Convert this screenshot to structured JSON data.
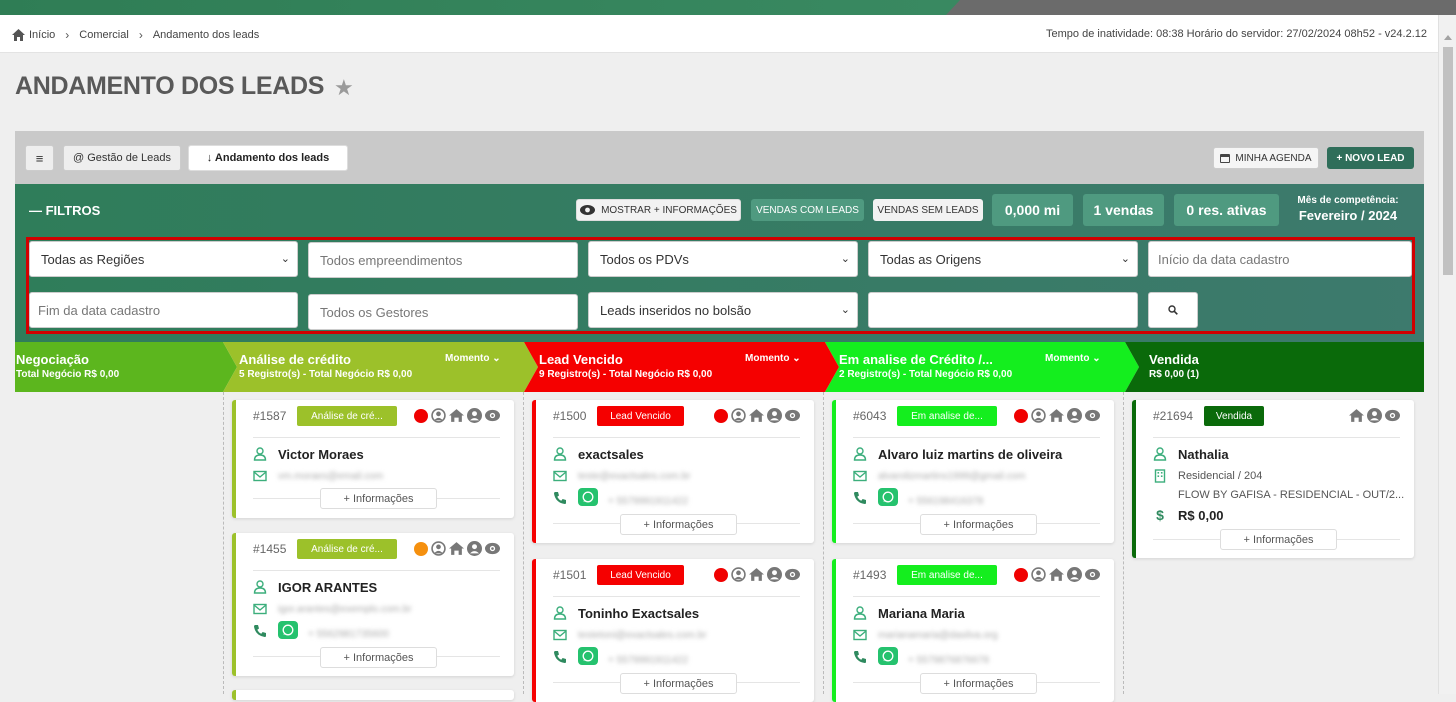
{
  "breadcrumb": {
    "items": [
      "Início",
      "Comercial",
      "Andamento dos leads"
    ]
  },
  "server_info": "Tempo de inatividade: 08:38   Horário do servidor: 27/02/2024 08h52 - v24.2.12",
  "page_title": "ANDAMENTO DOS LEADS",
  "toolbar": {
    "tab_gestao": "@ Gestão de Leads",
    "tab_andamento": "↓ Andamento dos leads",
    "agenda": "MINHA AGENDA",
    "novo_lead": "+ NOVO LEAD"
  },
  "filters": {
    "title": "— FILTROS",
    "mostrar": "MOSTRAR + INFORMAÇÕES",
    "vendas_com": "VENDAS COM LEADS",
    "vendas_sem": "VENDAS SEM LEADS",
    "stat1": "0,000 mi",
    "stat2": "1 vendas",
    "stat3": "0 res. ativas",
    "mes_label": "Mês de competência:",
    "mes_value": "Fevereiro / 2024",
    "regioes": "Todas as Regiões",
    "empreend": "Todos empreendimentos",
    "pdvs": "Todos os PDVs",
    "origens": "Todas as Origens",
    "inicio": "Início da data cadastro",
    "fim": "Fim da data cadastro",
    "gestores": "Todos os Gestores",
    "bolsao": "Leads inseridos no bolsão",
    "extra": ""
  },
  "stages": [
    {
      "name": "Negociação",
      "sub": "Total Negócio R$ 0,00",
      "color": "#5cb61e"
    },
    {
      "name": "Análise de crédito",
      "sub": "5 Registro(s) - Total Negócio R$ 0,00",
      "momento": "Momento",
      "color": "#9cc12a"
    },
    {
      "name": "Lead Vencido",
      "sub": "9 Registro(s) - Total Negócio R$ 0,00",
      "momento": "Momento",
      "color": "#f50000"
    },
    {
      "name": "Em analise de Crédito /...",
      "sub": "2 Registro(s) - Total Negócio R$ 0,00",
      "momento": "Momento",
      "color": "#14ee1e"
    },
    {
      "name": "Vendida",
      "sub": "R$ 0,00 (1)",
      "color": "#0a6a0a"
    }
  ],
  "cards": {
    "c1": {
      "id": "#1587",
      "badge": "Análise de cré...",
      "name": "Victor Moraes",
      "email": "vm.moraes@email.com",
      "info": "+ Informações"
    },
    "c2": {
      "id": "#1455",
      "badge": "Análise de cré...",
      "name": "IGOR ARANTES",
      "email": "igor.arantes@exemplo.com.br",
      "phone": "+ 5562981735600",
      "info": "+ Informações"
    },
    "c3": {
      "id": "#1500",
      "badge": "Lead Vencido",
      "name": "exactsales",
      "email": "teste@exactsales.com.br",
      "phone": "+ 5579991911422",
      "info": "+ Informações"
    },
    "c4": {
      "id": "#1501",
      "badge": "Lead Vencido",
      "name": "Toninho Exactsales",
      "email": "testetoni@exactsales.com.br",
      "phone": "+ 5579991911422",
      "info": "+ Informações"
    },
    "c5": {
      "id": "#6043",
      "badge": "Em analise de...",
      "name": "Alvaro luiz martins de oliveira",
      "email": "alvarolizmartins1999@gmail.com",
      "phone": "+ 556198416378",
      "info": "+ Informações"
    },
    "c6": {
      "id": "#1493",
      "badge": "Em analise de...",
      "name": "Mariana Maria",
      "email": "marianamaria@dasilva.org",
      "phone": "+ 5579876876678",
      "info": "+ Informações"
    },
    "c7": {
      "id": "#21694",
      "badge": "Vendida",
      "name": "Nathalia",
      "unit": "Residencial / 204",
      "project": "FLOW BY GAFISA - RESIDENCIAL - OUT/2...",
      "price": "R$ 0,00",
      "info": "+ Informações"
    }
  }
}
